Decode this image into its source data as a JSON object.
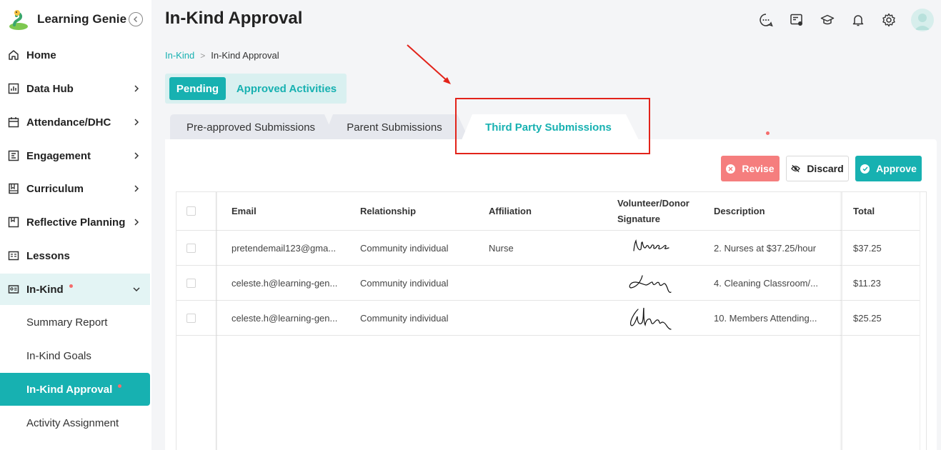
{
  "app": {
    "name": "Learning Genie"
  },
  "sidebar": {
    "items": [
      {
        "label": "Home",
        "icon": "home-icon"
      },
      {
        "label": "Data Hub",
        "icon": "chart-icon"
      },
      {
        "label": "Attendance/DHC",
        "icon": "calendar-icon"
      },
      {
        "label": "Engagement",
        "icon": "engagement-icon"
      },
      {
        "label": "Curriculum",
        "icon": "book-icon"
      },
      {
        "label": "Reflective Planning",
        "icon": "planning-icon"
      },
      {
        "label": "Lessons",
        "icon": "lessons-icon"
      },
      {
        "label": "In-Kind",
        "icon": "inkind-icon"
      }
    ],
    "subitems": [
      {
        "label": "Summary Report"
      },
      {
        "label": "In-Kind Goals"
      },
      {
        "label": "In-Kind Approval"
      },
      {
        "label": "Activity Assignment"
      }
    ]
  },
  "header": {
    "title": "In-Kind Approval"
  },
  "breadcrumb": {
    "parent": "In-Kind",
    "sep": ">",
    "current": "In-Kind Approval"
  },
  "segment": {
    "pending": "Pending",
    "approved": "Approved Activities"
  },
  "tabs": {
    "preapproved": "Pre-approved Submissions",
    "parent": "Parent Submissions",
    "third": "Third Party Submissions"
  },
  "actions": {
    "revise": "Revise",
    "discard": "Discard",
    "approve": "Approve"
  },
  "table": {
    "headers": {
      "email": "Email",
      "relationship": "Relationship",
      "affiliation": "Affiliation",
      "signature_line1": "Volunteer/Donor",
      "signature_line2": "Signature",
      "description": "Description",
      "total": "Total"
    },
    "rows": [
      {
        "email": "pretendemail123@gma...",
        "relationship": "Community individual",
        "affiliation": "Nurse",
        "description": "2. Nurses at $37.25/hour",
        "total": "$37.25"
      },
      {
        "email": "celeste.h@learning-gen...",
        "relationship": "Community individual",
        "affiliation": "",
        "description": "4. Cleaning Classroom/...",
        "total": "$11.23"
      },
      {
        "email": "celeste.h@learning-gen...",
        "relationship": "Community individual",
        "affiliation": "",
        "description": "10. Members Attending...",
        "total": "$25.25"
      }
    ]
  },
  "colors": {
    "accent": "#17b1b1",
    "danger": "#f57e7e",
    "highlight": "#e2231a",
    "dot": "#f56c6c"
  }
}
